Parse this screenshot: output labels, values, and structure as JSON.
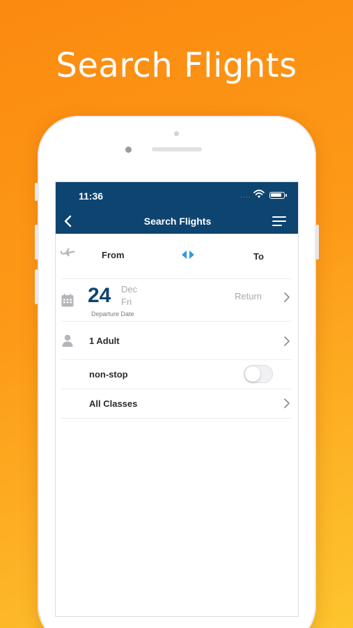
{
  "headline": "Search Flights",
  "status_bar": {
    "time": "11:36",
    "signal": "····"
  },
  "nav": {
    "title": "Search Flights"
  },
  "route": {
    "from_label": "From",
    "to_label": "To"
  },
  "date": {
    "day": "24",
    "month": "Dec",
    "weekday": "Fri",
    "caption": "Departure Date",
    "return_label": "Return"
  },
  "passengers": {
    "label": "1 Adult"
  },
  "nonstop": {
    "label": "non-stop",
    "enabled": false
  },
  "cabin": {
    "label": "All Classes"
  },
  "colors": {
    "brand_navy": "#0e4470",
    "accent_blue": "#2f9be0",
    "background_orange": "#fb8a10",
    "icon_grey": "#b5b5ba"
  },
  "icons": [
    "chevron-left-icon",
    "hamburger-menu-icon",
    "wifi-icon",
    "battery-icon",
    "airplane-icon",
    "swap-arrows-icon",
    "calendar-icon",
    "person-icon",
    "chevron-right-icon"
  ]
}
